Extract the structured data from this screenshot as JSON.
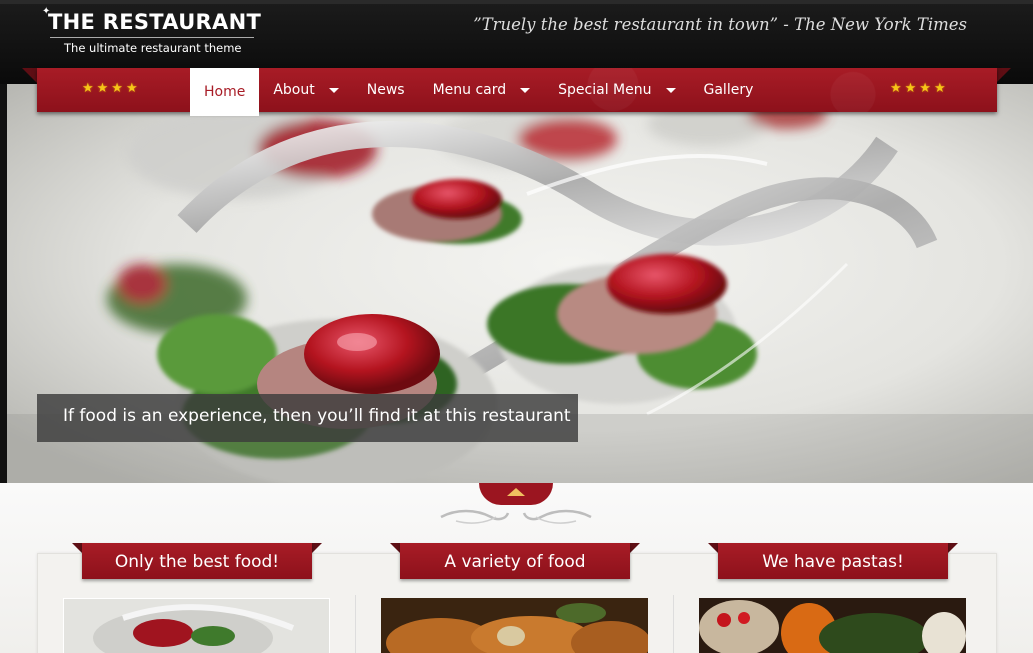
{
  "header": {
    "logo_title": "THE RESTAURANT",
    "logo_subtitle": "The ultimate restaurant theme",
    "quote": "”Truely the best restaurant in town” - The New York Times"
  },
  "nav": {
    "stars_left": "★★★★",
    "stars_right": "★★★★",
    "items": [
      {
        "label": "Home",
        "active": true,
        "has_dropdown": false
      },
      {
        "label": "About",
        "active": false,
        "has_dropdown": true
      },
      {
        "label": "News",
        "active": false,
        "has_dropdown": false
      },
      {
        "label": "Menu card",
        "active": false,
        "has_dropdown": true
      },
      {
        "label": "Special Menu",
        "active": false,
        "has_dropdown": true
      },
      {
        "label": "Gallery",
        "active": false,
        "has_dropdown": false
      }
    ]
  },
  "hero": {
    "caption": "If food is an experience, then you’ll find it at this restaurant"
  },
  "features": [
    {
      "title": "Only the best food!"
    },
    {
      "title": "A variety of food"
    },
    {
      "title": "We have pastas!"
    }
  ],
  "colors": {
    "accent_red": "#a81c26",
    "dark_bg": "#111111",
    "star_gold": "#f5c518"
  },
  "icons": {
    "slider_toggle": "up-arrow-icon",
    "ornament": "scroll-ornament-icon"
  }
}
